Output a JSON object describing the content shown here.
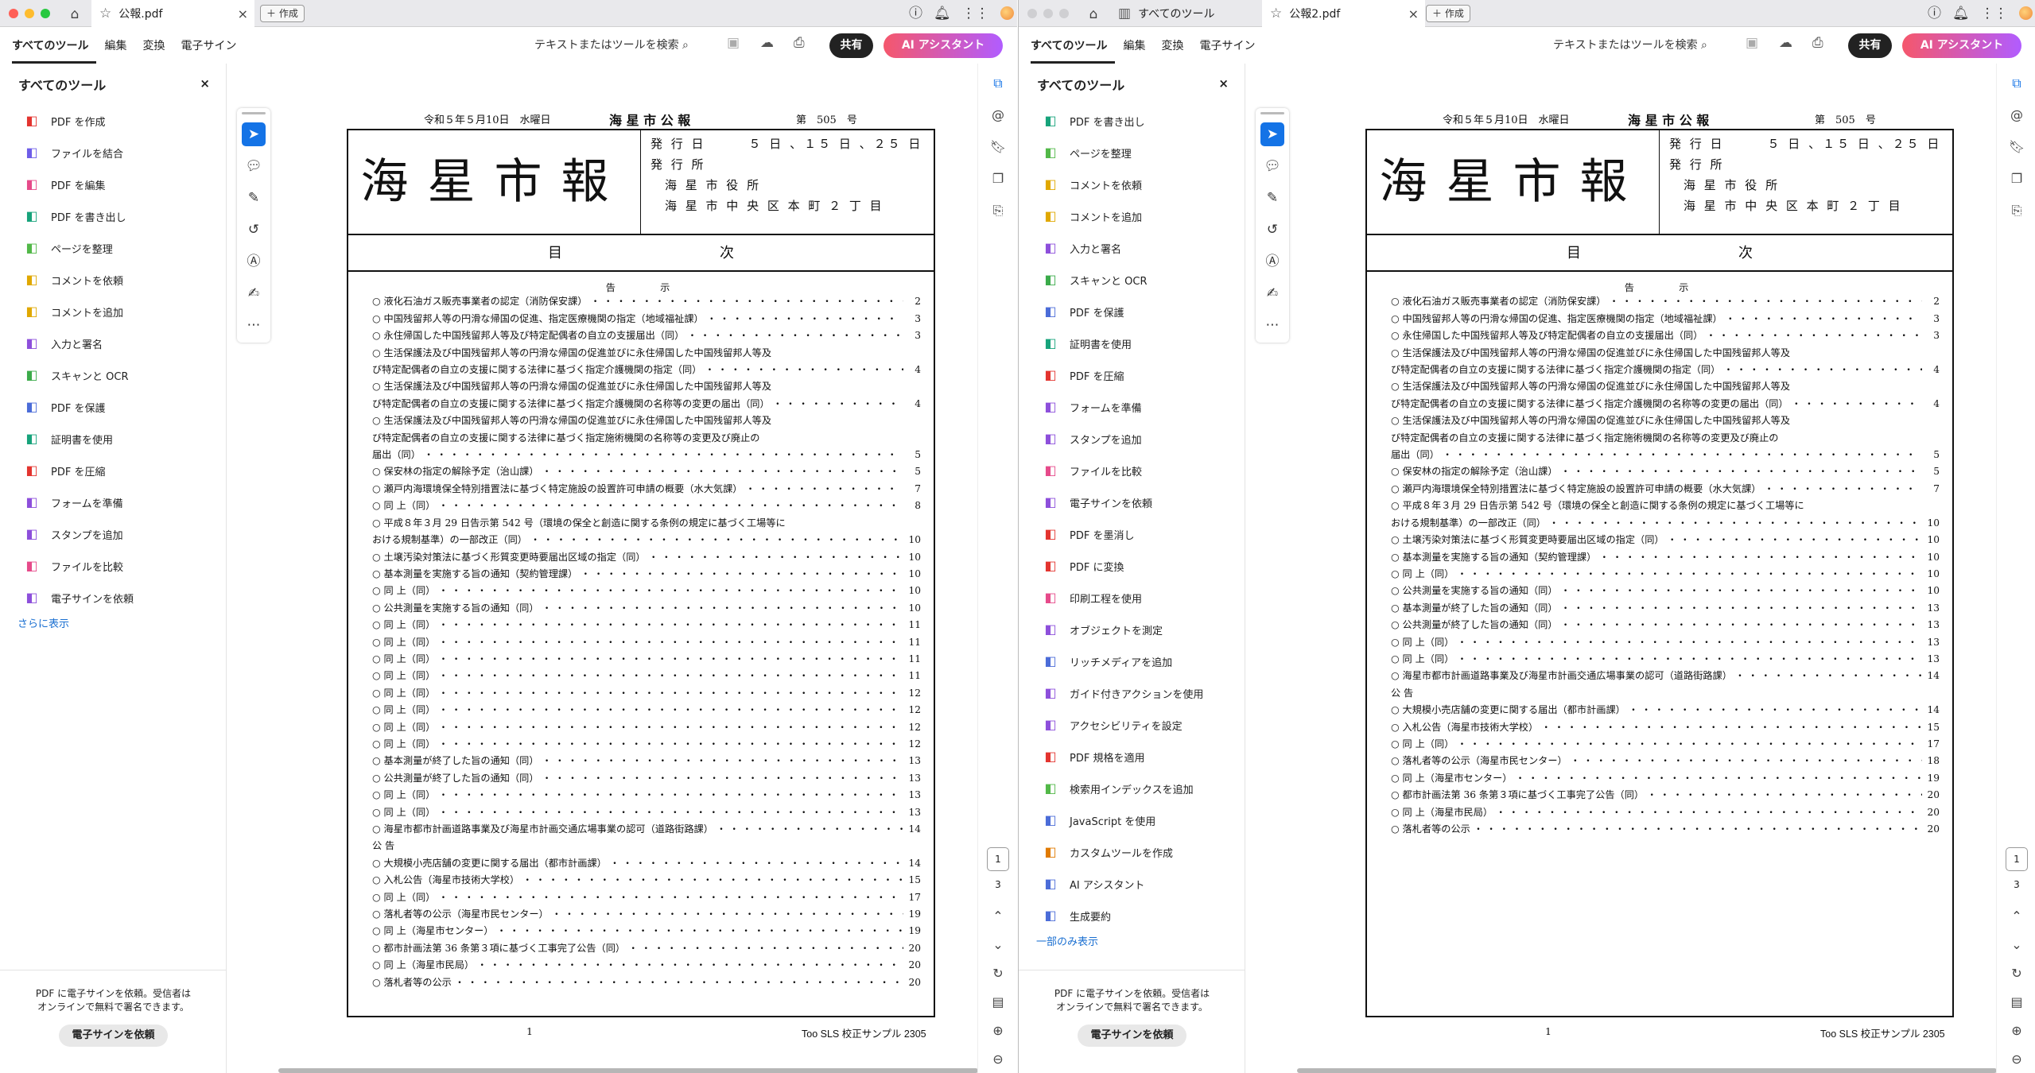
{
  "windows": [
    {
      "tabs": [
        {
          "label": "公報.pdf",
          "active": true
        }
      ],
      "new_tab_label": "作成",
      "menu": [
        "すべてのツール",
        "編集",
        "変換",
        "電子サイン"
      ],
      "search_label": "テキストまたはツールを検索",
      "share_label": "共有",
      "ai_label": "AI アシスタント",
      "panel": {
        "title": "すべてのツール",
        "items": [
          {
            "label": "PDF を作成",
            "icon": "create-pdf-icon",
            "color": "#e3342f"
          },
          {
            "label": "ファイルを結合",
            "icon": "combine-files-icon",
            "color": "#6e5de8"
          },
          {
            "label": "PDF を編集",
            "icon": "edit-pdf-icon",
            "color": "#e64a8a"
          },
          {
            "label": "PDF を書き出し",
            "icon": "export-pdf-icon",
            "color": "#17a37b"
          },
          {
            "label": "ページを整理",
            "icon": "organize-pages-icon",
            "color": "#52b848"
          },
          {
            "label": "コメントを依頼",
            "icon": "request-comments-icon",
            "color": "#e0a800"
          },
          {
            "label": "コメントを追加",
            "icon": "add-comment-icon",
            "color": "#e0a800"
          },
          {
            "label": "入力と署名",
            "icon": "fill-sign-icon",
            "color": "#8d4fdb"
          },
          {
            "label": "スキャンと OCR",
            "icon": "scan-ocr-icon",
            "color": "#3bab4a"
          },
          {
            "label": "PDF を保護",
            "icon": "protect-pdf-icon",
            "color": "#4b6cd8"
          },
          {
            "label": "証明書を使用",
            "icon": "certificate-icon",
            "color": "#17a37b"
          },
          {
            "label": "PDF を圧縮",
            "icon": "compress-pdf-icon",
            "color": "#e3342f"
          },
          {
            "label": "フォームを準備",
            "icon": "prepare-form-icon",
            "color": "#8d4fdb"
          },
          {
            "label": "スタンプを追加",
            "icon": "stamp-icon",
            "color": "#8d4fdb"
          },
          {
            "label": "ファイルを比較",
            "icon": "compare-files-icon",
            "color": "#e64a8a"
          },
          {
            "label": "電子サインを依頼",
            "icon": "request-esign-icon",
            "color": "#8d4fdb"
          }
        ],
        "more_label": "さらに表示",
        "promo_text": "PDF に電子サインを依頼。受信者は\nオンラインで無料で署名できます。",
        "promo_button": "電子サインを依頼"
      },
      "page_current": "1",
      "page_total": "3",
      "toc_visible_count": 40,
      "footer_page": "1",
      "footer_label": "Too SLS 校正サンプル 2305"
    },
    {
      "tabs": [
        {
          "label": "すべてのツール",
          "active": false
        },
        {
          "label": "公報2.pdf",
          "active": true
        }
      ],
      "new_tab_label": "作成",
      "menu": [
        "すべてのツール",
        "編集",
        "変換",
        "電子サイン"
      ],
      "search_label": "テキストまたはツールを検索",
      "share_label": "共有",
      "ai_label": "AI アシスタント",
      "panel": {
        "title": "すべてのツール",
        "items": [
          {
            "label": "PDF を書き出し",
            "icon": "export-pdf-icon",
            "color": "#17a37b"
          },
          {
            "label": "ページを整理",
            "icon": "organize-pages-icon",
            "color": "#52b848"
          },
          {
            "label": "コメントを依頼",
            "icon": "request-comments-icon",
            "color": "#e0a800"
          },
          {
            "label": "コメントを追加",
            "icon": "add-comment-icon",
            "color": "#e0a800"
          },
          {
            "label": "入力と署名",
            "icon": "fill-sign-icon",
            "color": "#8d4fdb"
          },
          {
            "label": "スキャンと OCR",
            "icon": "scan-ocr-icon",
            "color": "#3bab4a"
          },
          {
            "label": "PDF を保護",
            "icon": "protect-pdf-icon",
            "color": "#4b6cd8"
          },
          {
            "label": "証明書を使用",
            "icon": "certificate-icon",
            "color": "#17a37b"
          },
          {
            "label": "PDF を圧縮",
            "icon": "compress-pdf-icon",
            "color": "#e3342f"
          },
          {
            "label": "フォームを準備",
            "icon": "prepare-form-icon",
            "color": "#8d4fdb"
          },
          {
            "label": "スタンプを追加",
            "icon": "stamp-icon",
            "color": "#8d4fdb"
          },
          {
            "label": "ファイルを比較",
            "icon": "compare-files-icon",
            "color": "#e64a8a"
          },
          {
            "label": "電子サインを依頼",
            "icon": "request-esign-icon",
            "color": "#8d4fdb"
          },
          {
            "label": "PDF を墨消し",
            "icon": "redact-icon",
            "color": "#e3342f"
          },
          {
            "label": "PDF に変換",
            "icon": "convert-pdf-icon",
            "color": "#e3342f"
          },
          {
            "label": "印刷工程を使用",
            "icon": "print-production-icon",
            "color": "#e64a8a"
          },
          {
            "label": "オブジェクトを測定",
            "icon": "measure-icon",
            "color": "#8d4fdb"
          },
          {
            "label": "リッチメディアを追加",
            "icon": "rich-media-icon",
            "color": "#4b6cd8"
          },
          {
            "label": "ガイド付きアクションを使用",
            "icon": "guided-action-icon",
            "color": "#8d4fdb"
          },
          {
            "label": "アクセシビリティを設定",
            "icon": "accessibility-icon",
            "color": "#8d4fdb"
          },
          {
            "label": "PDF 規格を適用",
            "icon": "pdf-standards-icon",
            "color": "#e3342f"
          },
          {
            "label": "検索用インデックスを追加",
            "icon": "index-icon",
            "color": "#52b848"
          },
          {
            "label": "JavaScript を使用",
            "icon": "javascript-icon",
            "color": "#4b6cd8"
          },
          {
            "label": "カスタムツールを作成",
            "icon": "custom-tool-icon",
            "color": "#e07a00"
          },
          {
            "label": "AI アシスタント",
            "icon": "ai-assistant-icon",
            "color": "#4b6cd8"
          },
          {
            "label": "生成要約",
            "icon": "summary-icon",
            "color": "#4b6cd8"
          }
        ],
        "more_label": "一部のみ表示",
        "promo_text": "PDF に電子サインを依頼。受信者は\nオンラインで無料で署名できます。",
        "promo_button": "電子サインを依頼"
      },
      "page_current": "1",
      "page_total": "3",
      "toc_visible_count": 38,
      "footer_page": "1",
      "footer_label": "Too SLS 校正サンプル 2305"
    }
  ],
  "gazette": {
    "header_date": "令和５年５月10日　水曜日",
    "header_title": "海 星 市 公 報",
    "header_issue": "第　505　号",
    "title": "海星市報",
    "info": [
      "発 行 日　　　５ 日 、１５ 日 、２５ 日",
      "発 行 所",
      "　海 星 市 役 所",
      "　海 星 市 中 央 区 本 町 ２ 丁 目"
    ],
    "contents_label": "目　次",
    "section_label": "告　示"
  },
  "toc1": [
    {
      "t": "○ 液化石油ガス販売事業者の認定（消防保安課）",
      "n": "2"
    },
    {
      "t": "○ 中国残留邦人等の円滑な帰国の促進、指定医療機関の指定（地域福祉課）",
      "n": "3"
    },
    {
      "t": "○ 永住帰国した中国残留邦人等及び特定配偶者の自立の支援届出（同）",
      "n": "3"
    },
    {
      "c": "○ 生活保護法及び中国残留邦人等の円滑な帰国の促進並びに永住帰国した中国残留邦人等及"
    },
    {
      "t": "び特定配偶者の自立の支援に関する法律に基づく指定介護機関の指定（同）",
      "n": "4"
    },
    {
      "c": "○ 生活保護法及び中国残留邦人等の円滑な帰国の促進並びに永住帰国した中国残留邦人等及"
    },
    {
      "t": "び特定配偶者の自立の支援に関する法律に基づく指定介護機関の名称等の変更の届出（同）",
      "n": "4"
    },
    {
      "c": "○ 生活保護法及び中国残留邦人等の円滑な帰国の促進並びに永住帰国した中国残留邦人等及"
    },
    {
      "c": "び特定配偶者の自立の支援に関する法律に基づく指定施術機関の名称等の変更及び廃止の"
    },
    {
      "t": "届出（同）",
      "n": "5"
    },
    {
      "t": "○ 保安林の指定の解除予定（治山課）",
      "n": "5"
    },
    {
      "t": "○ 瀬戸内海環境保全特別措置法に基づく特定施設の設置許可申請の概要（水大気課）",
      "n": "7"
    },
    {
      "t": "○ 同 上（同）",
      "n": "8"
    },
    {
      "c": "○ 平成８年３月 29 日告示第 542 号（環境の保全と創造に関する条例の規定に基づく工場等に"
    },
    {
      "t": "おける規制基準）の一部改正（同）",
      "n": "10"
    },
    {
      "t": "○ 土壌汚染対策法に基づく形質変更時要届出区域の指定（同）",
      "n": "10"
    },
    {
      "t": "○ 基本測量を実施する旨の通知（契約管理課）",
      "n": "10"
    },
    {
      "t": "○ 同 上（同）",
      "n": "10"
    },
    {
      "t": "○ 公共測量を実施する旨の通知（同）",
      "n": "10"
    },
    {
      "t": "○ 同 上（同）",
      "n": "11"
    },
    {
      "t": "○ 同 上（同）",
      "n": "11"
    },
    {
      "t": "○ 同 上（同）",
      "n": "11"
    },
    {
      "t": "○ 同 上（同）",
      "n": "11"
    },
    {
      "t": "○ 同 上（同）",
      "n": "12"
    },
    {
      "t": "○ 同 上（同）",
      "n": "12"
    },
    {
      "t": "○ 同 上（同）",
      "n": "12"
    },
    {
      "t": "○ 同 上（同）",
      "n": "12"
    },
    {
      "t": "○ 基本測量が終了した旨の通知（同）",
      "n": "13"
    },
    {
      "t": "○ 公共測量が終了した旨の通知（同）",
      "n": "13"
    },
    {
      "t": "○ 同 上（同）",
      "n": "13"
    },
    {
      "t": "○ 同 上（同）",
      "n": "13"
    },
    {
      "t": "○ 海星市都市計画道路事業及び海星市計画交通広場事業の認可（道路街路課）",
      "n": "14"
    },
    {
      "c": "公 告"
    },
    {
      "t": "○ 大規模小売店舗の変更に関する届出（都市計画課）",
      "n": "14"
    },
    {
      "t": "○ 入札公告（海星市技術大学校）",
      "n": "15"
    },
    {
      "t": "○ 同 上（同）",
      "n": "17"
    },
    {
      "t": "○ 落札者等の公示（海星市民センター）",
      "n": "19"
    },
    {
      "t": "○ 同 上（海星市センター）",
      "n": "19"
    },
    {
      "t": "○ 都市計画法第 36 条第３項に基づく工事完了公告（同）",
      "n": "20"
    },
    {
      "t": "○ 同 上（海星市民局）",
      "n": "20"
    },
    {
      "t": "○ 落札者等の公示",
      "n": "20"
    }
  ],
  "toc2": [
    {
      "t": "○ 液化石油ガス販売事業者の認定（消防保安課）",
      "n": "2"
    },
    {
      "t": "○ 中国残留邦人等の円滑な帰国の促進、指定医療機関の指定（地域福祉課）",
      "n": "3"
    },
    {
      "t": "○ 永住帰国した中国残留邦人等及び特定配偶者の自立の支援届出（同）",
      "n": "3"
    },
    {
      "c": "○ 生活保護法及び中国残留邦人等の円滑な帰国の促進並びに永住帰国した中国残留邦人等及"
    },
    {
      "t": "び特定配偶者の自立の支援に関する法律に基づく指定介護機関の指定（同）",
      "n": "4"
    },
    {
      "c": "○ 生活保護法及び中国残留邦人等の円滑な帰国の促進並びに永住帰国した中国残留邦人等及"
    },
    {
      "t": "び特定配偶者の自立の支援に関する法律に基づく指定介護機関の名称等の変更の届出（同）",
      "n": "4"
    },
    {
      "c": "○ 生活保護法及び中国残留邦人等の円滑な帰国の促進並びに永住帰国した中国残留邦人等及"
    },
    {
      "c": "び特定配偶者の自立の支援に関する法律に基づく指定施術機関の名称等の変更及び廃止の"
    },
    {
      "t": "届出（同）",
      "n": "5"
    },
    {
      "t": "○ 保安林の指定の解除予定（治山課）",
      "n": "5"
    },
    {
      "t": "○ 瀬戸内海環境保全特別措置法に基づく特定施設の設置許可申請の概要（水大気課）",
      "n": "7"
    },
    {
      "c": "○ 平成８年３月 29 日告示第 542 号（環境の保全と創造に関する条例の規定に基づく工場等に"
    },
    {
      "t": "おける規制基準）の一部改正（同）",
      "n": "10"
    },
    {
      "t": "○ 土壌汚染対策法に基づく形質変更時要届出区域の指定（同）",
      "n": "10"
    },
    {
      "t": "○ 基本測量を実施する旨の通知（契約管理課）",
      "n": "10"
    },
    {
      "t": "○ 同 上（同）",
      "n": "10"
    },
    {
      "t": "○ 公共測量を実施する旨の通知（同）",
      "n": "10"
    },
    {
      "t": "○ 基本測量が終了した旨の通知（同）",
      "n": "13"
    },
    {
      "t": "○ 公共測量が終了した旨の通知（同）",
      "n": "13"
    },
    {
      "t": "○ 同 上（同）",
      "n": "13"
    },
    {
      "t": "○ 同 上（同）",
      "n": "13"
    },
    {
      "t": "○ 海星市都市計画道路事業及び海星市計画交通広場事業の認可（道路街路課）",
      "n": "14"
    },
    {
      "c": "公 告"
    },
    {
      "t": "○ 大規模小売店舗の変更に関する届出（都市計画課）",
      "n": "14"
    },
    {
      "t": "○ 入札公告（海星市技術大学校）",
      "n": "15"
    },
    {
      "t": "○ 同 上（同）",
      "n": "17"
    },
    {
      "t": "○ 落札者等の公示（海星市民センター）",
      "n": "18"
    },
    {
      "t": "○ 同 上（海星市センター）",
      "n": "19"
    },
    {
      "t": "○ 都市計画法第 36 条第３項に基づく工事完了公告（同）",
      "n": "20"
    },
    {
      "t": "○ 同 上（海星市民局）",
      "n": "20"
    },
    {
      "t": "○ 落札者等の公示",
      "n": "20"
    }
  ]
}
